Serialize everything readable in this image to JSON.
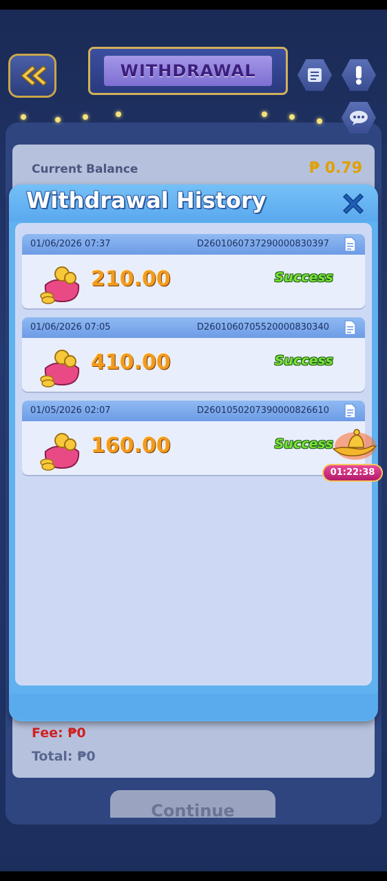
{
  "header": {
    "title": "WITHDRAWAL",
    "back_icon": "double-chevron-left-icon",
    "history_icon": "history-list-icon",
    "info_icon": "exclamation-icon",
    "chat_icon": "chat-icon"
  },
  "balance": {
    "label": "Current Balance",
    "value": "₱ 0.79"
  },
  "form": {
    "fee": "Fee: ₱0",
    "total": "Total: ₱0",
    "continue": "Continue"
  },
  "modal": {
    "title": "Withdrawal History",
    "close_icon": "close-icon",
    "records": [
      {
        "date": "01/06/2026 07:37",
        "id": "D2601060737290000830397",
        "amount": "210.00",
        "status": "Success"
      },
      {
        "date": "01/06/2026 07:05",
        "id": "D2601060705520000830340",
        "amount": "410.00",
        "status": "Success"
      },
      {
        "date": "01/05/2026 02:07",
        "id": "D2601050207390000826610",
        "amount": "160.00",
        "status": "Success"
      }
    ]
  },
  "promo": {
    "timer": "01:22:38",
    "icon": "magic-lamp-icon"
  },
  "colors": {
    "accent": "#5fb1f0",
    "success": "#7ae23a",
    "amount": "#f29b1e",
    "fee": "#d22020"
  }
}
